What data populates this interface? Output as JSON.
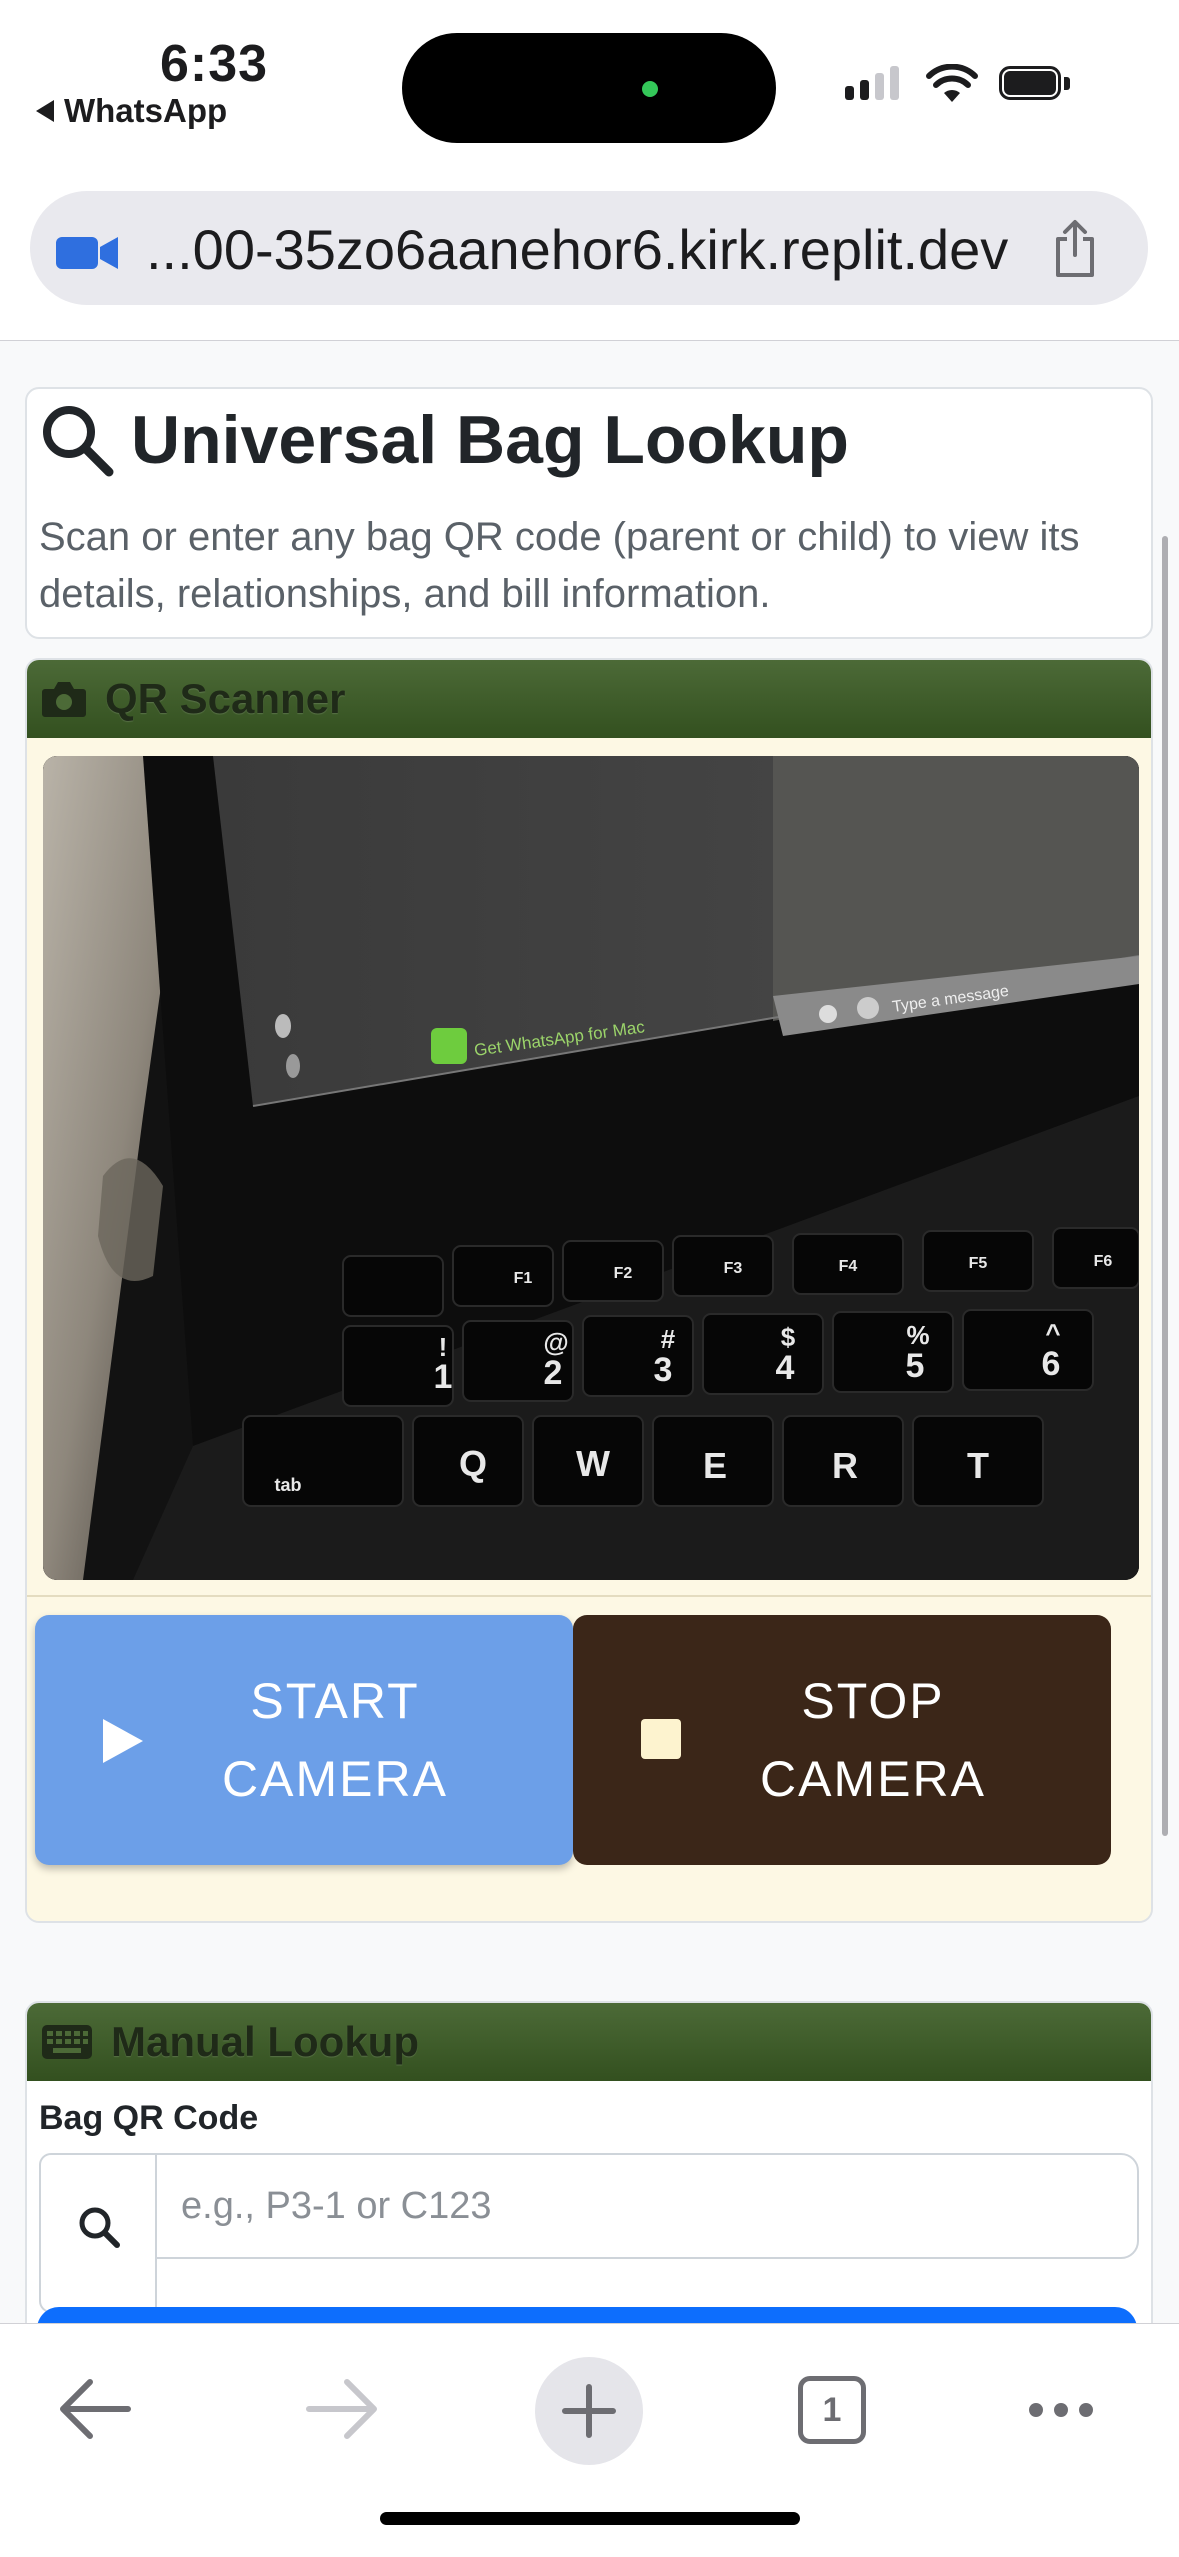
{
  "status_bar": {
    "time": "6:33",
    "back_app": "WhatsApp"
  },
  "browser": {
    "url": "...00-35zo6aanehor6.kirk.replit.dev",
    "tab_count": "1"
  },
  "page": {
    "title": "Universal Bag Lookup",
    "subtitle": "Scan or enter any bag QR code (parent or child) to view its details, relationships, and bill information."
  },
  "scanner": {
    "header": "QR Scanner",
    "start_label_1": "START",
    "start_label_2": "CAMERA",
    "stop_label_1": "STOP",
    "stop_label_2": "CAMERA",
    "preview": {
      "laptop_banner": "Get WhatsApp for Mac",
      "laptop_input": "Type a message",
      "key_rows": [
        [
          "F1",
          "F2",
          "F3",
          "F4",
          "F5",
          "F6"
        ],
        [
          "1",
          "2",
          "3",
          "4",
          "5",
          "6"
        ],
        [
          "Q",
          "W",
          "E",
          "R",
          "T"
        ]
      ],
      "key_symbols": [
        "!",
        "@",
        "#",
        "$",
        "%",
        "^"
      ],
      "tab_key": "tab"
    }
  },
  "manual": {
    "header": "Manual Lookup",
    "field_label": "Bag QR Code",
    "placeholder": "e.g., P3-1 or C123"
  },
  "colors": {
    "header_green": "#3e5b2a",
    "start_button": "#6c9fe8",
    "stop_button": "#3b2618",
    "lookup_blue": "#0d6efd"
  }
}
